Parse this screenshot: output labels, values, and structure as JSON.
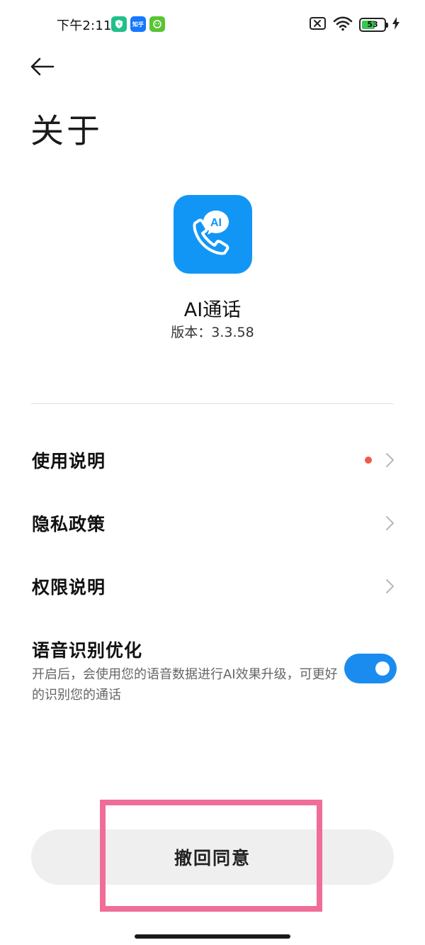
{
  "status_bar": {
    "time": "下午2:11",
    "notification_icons": [
      "shield-app-icon",
      "zhihu-app-icon",
      "wechat-mini-app-icon"
    ],
    "zhihu_label": "知乎",
    "battery_level": "53",
    "icons": [
      "sim-off-icon",
      "wifi-icon",
      "battery-icon",
      "charging-icon"
    ]
  },
  "header": {
    "back_icon": "arrow-left-icon",
    "title": "关于"
  },
  "app": {
    "name": "AI通话",
    "version_label": "版本：",
    "version": "3.3.58",
    "icon": "phone-ai-icon",
    "icon_badge": "AI",
    "icon_color": "#1296f6"
  },
  "menu": {
    "items": [
      {
        "label": "使用说明",
        "has_red_dot": true
      },
      {
        "label": "隐私政策",
        "has_red_dot": false
      },
      {
        "label": "权限说明",
        "has_red_dot": false
      }
    ]
  },
  "voice_optimization": {
    "title": "语音识别优化",
    "description": "开启后，会使用您的语音数据进行AI效果升级，可更好的识别您的通话",
    "enabled": true
  },
  "footer": {
    "revoke_label": "撤回同意"
  },
  "colors": {
    "accent": "#1a8cf0",
    "red_dot": "#f15a4a",
    "highlight": "#f06d97"
  }
}
